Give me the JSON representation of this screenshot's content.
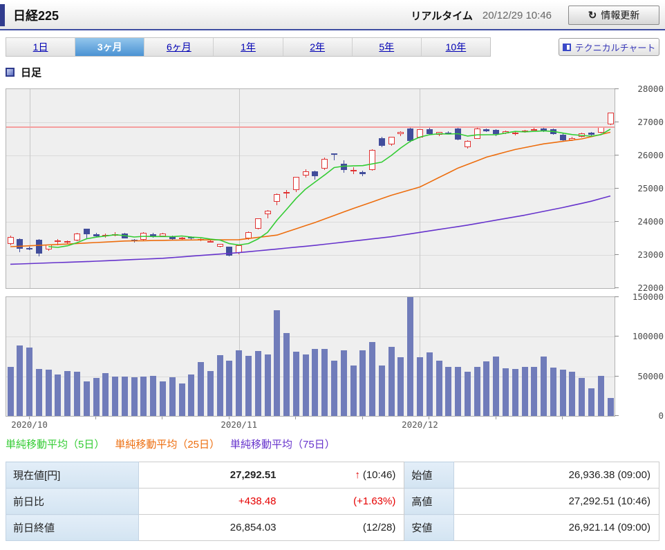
{
  "header": {
    "title": "日経225",
    "realtime_label": "リアルタイム",
    "timestamp": "20/12/29 10:46",
    "refresh_button_label": "情報更新"
  },
  "icons": {
    "refresh": "↻",
    "up_arrow": "↑"
  },
  "toolbar": {
    "tabs": [
      {
        "label": "1日",
        "active": false
      },
      {
        "label": "3ヶ月",
        "active": true
      },
      {
        "label": "6ヶ月",
        "active": false
      },
      {
        "label": "1年",
        "active": false
      },
      {
        "label": "2年",
        "active": false
      },
      {
        "label": "5年",
        "active": false
      },
      {
        "label": "10年",
        "active": false
      }
    ],
    "technical_chart_button_label": "テクニカルチャート"
  },
  "chart_section": {
    "period_label": "日足"
  },
  "legend": {
    "items": [
      {
        "label": "単純移動平均（5日）",
        "color": "#33cc33"
      },
      {
        "label": "単純移動平均（25日）",
        "color": "#ed6d0d"
      },
      {
        "label": "単純移動平均（75日）",
        "color": "#6633cc"
      }
    ]
  },
  "quote_table": {
    "left_rows": [
      {
        "label": "現在値[円]",
        "value": "27,292.51",
        "arrow": "↑",
        "sub": "(10:46)"
      },
      {
        "label": "前日比",
        "value": "+438.48",
        "sub": "(+1.63%)"
      },
      {
        "label": "前日終値",
        "value": "26,854.03",
        "sub": "(12/28)"
      }
    ],
    "right_rows": [
      {
        "label": "始値",
        "value": "26,936.38 (09:00)"
      },
      {
        "label": "高値",
        "value": "27,292.51 (10:46)"
      },
      {
        "label": "安値",
        "value": "26,921.14 (09:00)"
      }
    ]
  },
  "chart_data": {
    "type": "candlestick",
    "title": "日足",
    "price_axis": {
      "min": 22000,
      "max": 28000,
      "ticks": [
        28000,
        27000,
        26000,
        25000,
        24000,
        23000,
        22000
      ]
    },
    "volume_axis": {
      "min": 0,
      "max": 150000,
      "ticks": [
        150000,
        100000,
        50000,
        0
      ]
    },
    "x_axis": {
      "month_labels": [
        "2020/10",
        "2020/11",
        "2020/12"
      ],
      "month_start_indices": [
        2,
        24,
        43
      ],
      "week_tick_start": 2,
      "week_tick_step": 7
    },
    "prev_close": 26854.03,
    "current_price": 27292.51,
    "colors": {
      "up": "#e03232",
      "down": "#414d9b",
      "volume": "#707cba",
      "ma5": "#33cc33",
      "ma25": "#ed6d0d",
      "ma75": "#6633cc",
      "prev_close_line": "#f59e9e",
      "grid": "#dadada",
      "grid_vertical": "#c8c8c8",
      "plot_bg": "#efefef"
    },
    "ma5_window": 5,
    "candles": [
      [
        23330,
        23590,
        23300,
        23540
      ],
      [
        23480,
        23500,
        23090,
        23185
      ],
      [
        23200,
        23240,
        23140,
        23180
      ],
      [
        23450,
        23480,
        22950,
        23040
      ],
      [
        23160,
        23320,
        23120,
        23310
      ],
      [
        23390,
        23470,
        23300,
        23435
      ],
      [
        23380,
        23440,
        23330,
        23425
      ],
      [
        23430,
        23660,
        23420,
        23645
      ],
      [
        23790,
        23800,
        23480,
        23620
      ],
      [
        23630,
        23670,
        23540,
        23560
      ],
      [
        23560,
        23640,
        23520,
        23600
      ],
      [
        23580,
        23680,
        23570,
        23630
      ],
      [
        23640,
        23660,
        23490,
        23505
      ],
      [
        23450,
        23480,
        23370,
        23410
      ],
      [
        23450,
        23680,
        23440,
        23670
      ],
      [
        23620,
        23660,
        23520,
        23565
      ],
      [
        23570,
        23660,
        23550,
        23640
      ],
      [
        23560,
        23580,
        23440,
        23475
      ],
      [
        23500,
        23550,
        23460,
        23515
      ],
      [
        23550,
        23560,
        23460,
        23495
      ],
      [
        23470,
        23510,
        23420,
        23485
      ],
      [
        23420,
        23450,
        23380,
        23420
      ],
      [
        23250,
        23340,
        23230,
        23330
      ],
      [
        23240,
        23260,
        22948,
        22977
      ],
      [
        23060,
        23310,
        23030,
        23295
      ],
      [
        23500,
        23700,
        23460,
        23695
      ],
      [
        23800,
        24110,
        23780,
        24105
      ],
      [
        24230,
        24350,
        24100,
        24325
      ],
      [
        24600,
        24850,
        24500,
        24840
      ],
      [
        24890,
        24950,
        24700,
        24905
      ],
      [
        24950,
        25360,
        24900,
        25350
      ],
      [
        25400,
        25590,
        25340,
        25520
      ],
      [
        25520,
        25550,
        25280,
        25385
      ],
      [
        25600,
        25940,
        25560,
        25905
      ],
      [
        26060,
        26070,
        25850,
        26015
      ],
      [
        25740,
        25860,
        25480,
        25560
      ],
      [
        25560,
        25640,
        25440,
        25560
      ],
      [
        25500,
        25540,
        25380,
        25430
      ],
      [
        25560,
        26180,
        25550,
        26165
      ],
      [
        26520,
        26560,
        26260,
        26290
      ],
      [
        26330,
        26570,
        26300,
        26560
      ],
      [
        26640,
        26730,
        26590,
        26700
      ],
      [
        26820,
        26840,
        26390,
        26430
      ],
      [
        26550,
        26800,
        26520,
        26790
      ],
      [
        26800,
        26830,
        26620,
        26650
      ],
      [
        26620,
        26710,
        26590,
        26700
      ],
      [
        26690,
        26730,
        26640,
        26660
      ],
      [
        26820,
        26850,
        26450,
        26480
      ],
      [
        26240,
        26450,
        26200,
        26440
      ],
      [
        26500,
        26840,
        26490,
        26820
      ],
      [
        26790,
        26810,
        26700,
        26730
      ],
      [
        26770,
        26790,
        26590,
        26650
      ],
      [
        26660,
        26760,
        26640,
        26735
      ],
      [
        26690,
        26720,
        26600,
        26690
      ],
      [
        26700,
        26780,
        26680,
        26760
      ],
      [
        26790,
        26830,
        26740,
        26800
      ],
      [
        26810,
        26830,
        26700,
        26720
      ],
      [
        26790,
        26810,
        26620,
        26650
      ],
      [
        26620,
        26660,
        26420,
        26450
      ],
      [
        26460,
        26560,
        26430,
        26530
      ],
      [
        26560,
        26690,
        26540,
        26670
      ],
      [
        26690,
        26710,
        26590,
        26620
      ],
      [
        26690,
        26860,
        26670,
        26854
      ],
      [
        26936,
        27292,
        26921,
        27292
      ]
    ],
    "volumes": [
      62000,
      89000,
      86000,
      59000,
      58000,
      52000,
      57000,
      56000,
      44000,
      48000,
      54000,
      50000,
      50000,
      49000,
      50000,
      51000,
      44000,
      49000,
      41000,
      52000,
      68000,
      57000,
      77000,
      70000,
      83000,
      76000,
      82000,
      78000,
      133000,
      105000,
      81000,
      78000,
      85000,
      85000,
      70000,
      83000,
      64000,
      83000,
      93000,
      64000,
      87000,
      74000,
      150000,
      74000,
      80000,
      70000,
      62000,
      62000,
      56000,
      62000,
      69000,
      75000,
      60000,
      59000,
      62000,
      62000,
      75000,
      61000,
      58000,
      56000,
      48000,
      35000,
      51000,
      23000
    ],
    "ma25_points": [
      [
        0,
        23250
      ],
      [
        6,
        23330
      ],
      [
        12,
        23420
      ],
      [
        18,
        23450
      ],
      [
        24,
        23460
      ],
      [
        28,
        23600
      ],
      [
        32,
        23980
      ],
      [
        36,
        24400
      ],
      [
        40,
        24800
      ],
      [
        43,
        25050
      ],
      [
        47,
        25620
      ],
      [
        50,
        25950
      ],
      [
        53,
        26180
      ],
      [
        56,
        26350
      ],
      [
        60,
        26500
      ],
      [
        63,
        26700
      ]
    ],
    "ma75_points": [
      [
        0,
        22720
      ],
      [
        8,
        22800
      ],
      [
        16,
        22900
      ],
      [
        24,
        23070
      ],
      [
        32,
        23290
      ],
      [
        40,
        23550
      ],
      [
        48,
        23900
      ],
      [
        54,
        24200
      ],
      [
        58,
        24430
      ],
      [
        61,
        24620
      ],
      [
        63,
        24780
      ]
    ]
  }
}
